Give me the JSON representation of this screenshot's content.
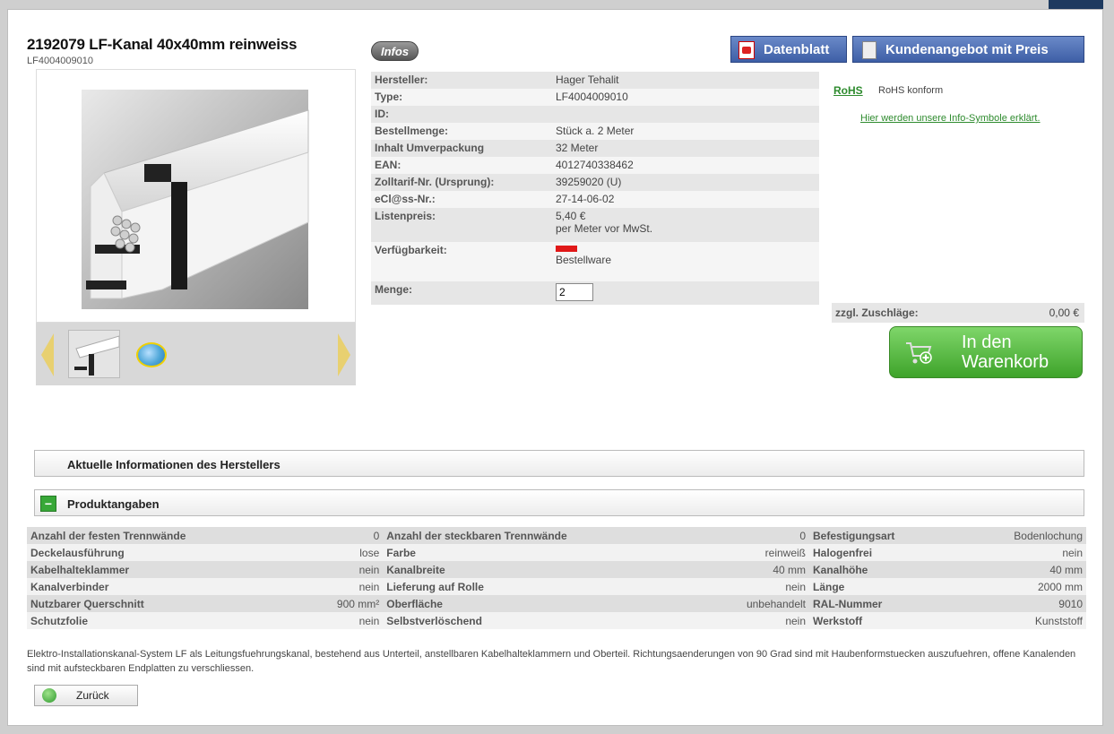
{
  "product": {
    "title": "2192079 LF-Kanal 40x40mm reinweiss",
    "subtitle": "LF4004009010"
  },
  "buttons": {
    "infos": "Infos",
    "datenblatt": "Datenblatt",
    "kundenangebot": "Kundenangebot mit Preis",
    "cart_line1": "In den",
    "cart_line2": "Warenkorb",
    "zurueck": "Zurück"
  },
  "attributes": [
    {
      "key": "Hersteller:",
      "value": "Hager Tehalit"
    },
    {
      "key": "Type:",
      "value": "LF4004009010"
    },
    {
      "key": "ID:",
      "value": ""
    },
    {
      "key": "Bestellmenge:",
      "value": "Stück a. 2 Meter"
    },
    {
      "key": "Inhalt Umverpackung",
      "value": "32 Meter"
    },
    {
      "key": "EAN:",
      "value": "4012740338462"
    },
    {
      "key": "Zolltarif-Nr. (Ursprung):",
      "value": "39259020 (U)"
    },
    {
      "key": "eCl@ss-Nr.:",
      "value": "27-14-06-02"
    }
  ],
  "price": {
    "key": "Listenpreis:",
    "value": "5,40 €",
    "note": "per Meter vor MwSt."
  },
  "availability": {
    "key": "Verfügbarkeit:",
    "status": "Bestellware",
    "color": "#e01818"
  },
  "quantity": {
    "key": "Menge:",
    "value": "2"
  },
  "rohs": {
    "label": "RoHS",
    "text": "RoHS konform",
    "link": "Hier werden unsere Info-Symbole erklärt."
  },
  "surcharge": {
    "label": "zzgl. Zuschläge:",
    "value": "0,00 €"
  },
  "sections": {
    "manufacturer_info": "Aktuelle Informationen des Herstellers",
    "product_specs": "Produktangaben",
    "expand_symbol": "−"
  },
  "specs": [
    [
      "Anzahl der festen Trennwände",
      "0",
      "Anzahl der steckbaren Trennwände",
      "0",
      "Befestigungsart",
      "Bodenlochung"
    ],
    [
      "Deckelausführung",
      "lose",
      "Farbe",
      "reinweiß",
      "Halogenfrei",
      "nein"
    ],
    [
      "Kabelhalteklammer",
      "nein",
      "Kanalbreite",
      "40 mm",
      "Kanalhöhe",
      "40 mm"
    ],
    [
      "Kanalverbinder",
      "nein",
      "Lieferung auf Rolle",
      "nein",
      "Länge",
      "2000 mm"
    ],
    [
      "Nutzbarer Querschnitt",
      "900 mm²",
      "Oberfläche",
      "unbehandelt",
      "RAL-Nummer",
      "9010"
    ],
    [
      "Schutzfolie",
      "nein",
      "Selbstverlöschend",
      "nein",
      "Werkstoff",
      "Kunststoff"
    ]
  ],
  "description": "Elektro-Installationskanal-System LF als Leitungsfuehrungskanal, bestehend aus Unterteil, anstellbaren Kabelhalteklammern und Oberteil. Richtungsaenderungen von 90 Grad sind mit Haubenformstuecken auszufuehren, offene Kanalenden sind mit aufsteckbaren Endplatten zu verschliessen.",
  "colors": {
    "accent_blue": "#3e5fa6",
    "green": "#3ea32a"
  }
}
